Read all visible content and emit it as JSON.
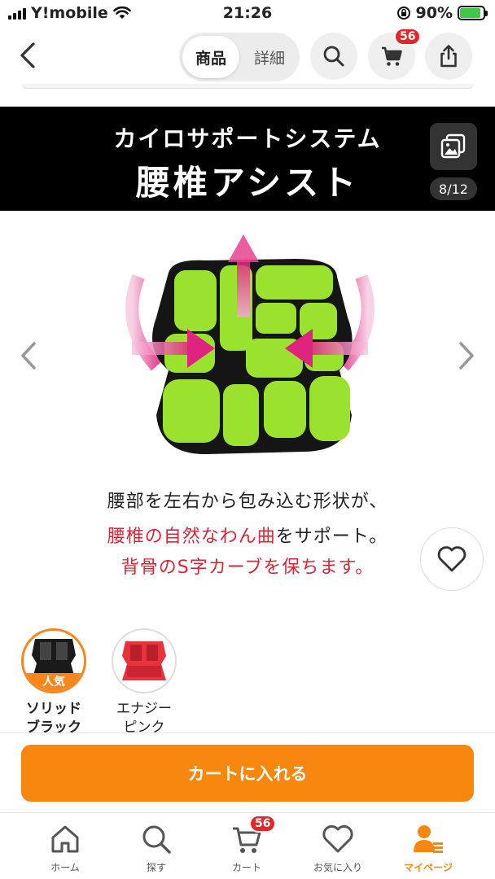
{
  "status_bar": {
    "carrier": "Y!mobile",
    "time": "21:26",
    "battery": "90%",
    "battery_level": 0.9
  },
  "nav": {
    "segment_product": "商品",
    "segment_detail": "詳細",
    "cart_count": "56"
  },
  "banner": {
    "line1": "カイロサポートシステム",
    "line2": "腰椎アシスト",
    "page_indicator": "8/12"
  },
  "description": {
    "line1": "腰部を左右から包み込む形状が、",
    "line2_red": "腰椎の自然なわん曲",
    "line2_rest": "をサポート。",
    "line3": "背骨のS字カーブを保ちます。"
  },
  "variants": [
    {
      "line1": "ソリッド",
      "line2": "ブラック",
      "badge": "人気",
      "color": "#1a1a1a"
    },
    {
      "line1": "エナジー",
      "line2": "ピンク",
      "color": "#e8333c"
    }
  ],
  "add_to_cart": "カートに入れる",
  "tabbar": {
    "home": "ホーム",
    "search": "探す",
    "cart": "カート",
    "cart_count": "56",
    "favorites": "お気に入り",
    "mypage": "マイページ"
  },
  "colors": {
    "accent": "#f7870f",
    "badge": "#e3262a",
    "cushion": "#9be22e",
    "text_red": "#d4283a"
  }
}
